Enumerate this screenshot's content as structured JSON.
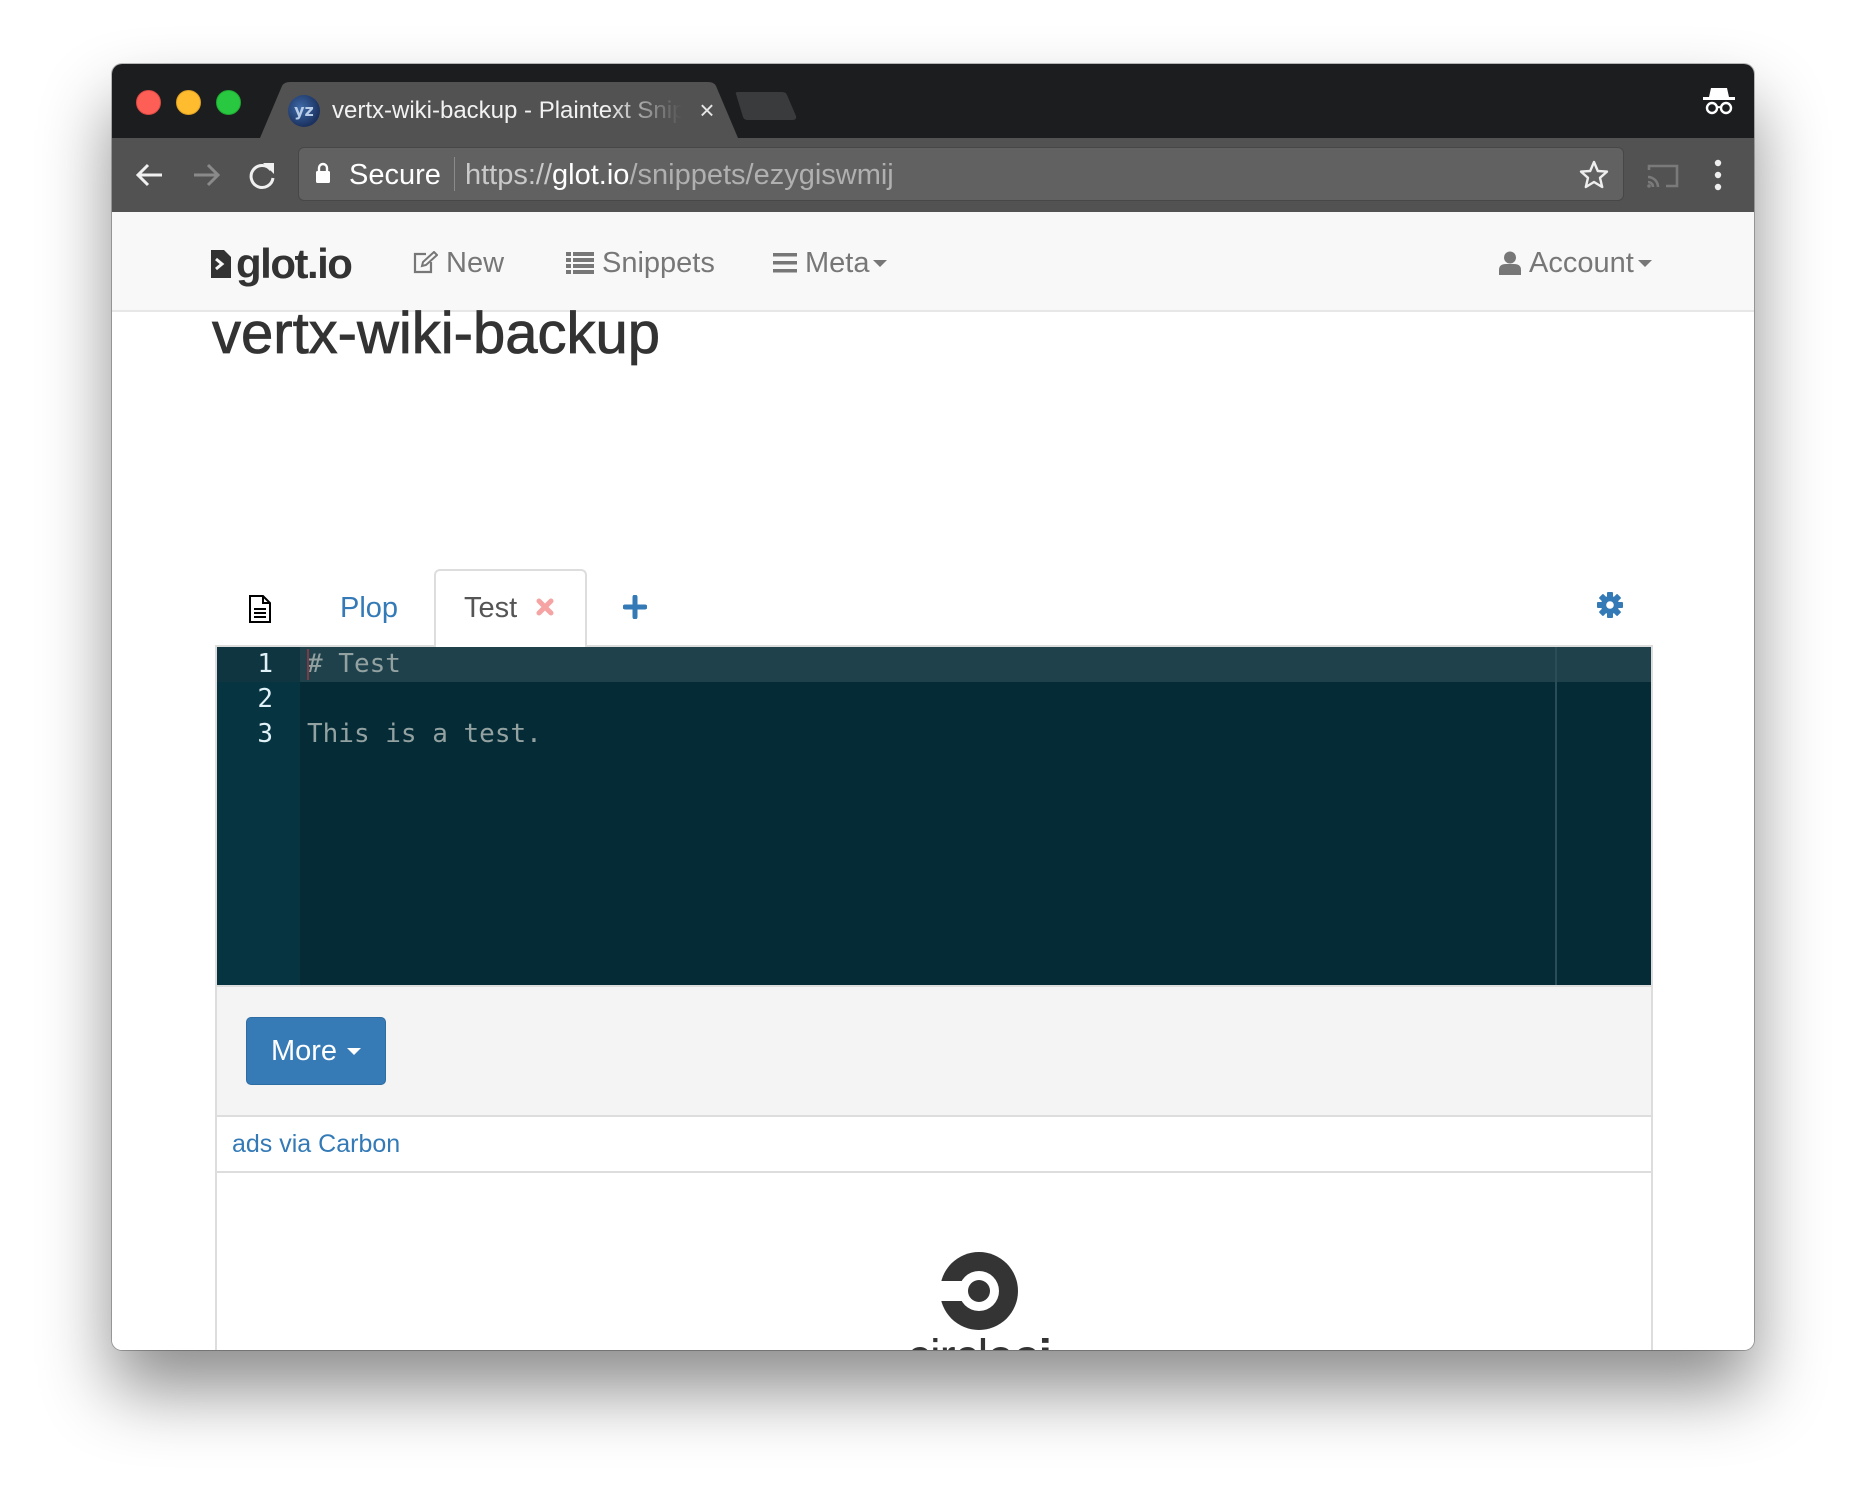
{
  "browser": {
    "tab": {
      "title": "vertx-wiki-backup - Plaintext Snippet",
      "favicon": "yz",
      "close_glyph": "×"
    },
    "toolbar": {
      "secure_label": "Secure",
      "url_scheme": "https://",
      "url_host": "glot.io",
      "url_path": "/snippets/ezygiswmij"
    },
    "icons": [
      "back-icon",
      "forward-icon",
      "reload-icon",
      "lock-icon",
      "star-icon",
      "cast-icon",
      "menu-dots-icon",
      "incognito-icon"
    ]
  },
  "navbar": {
    "brand": "glot.io",
    "items": [
      {
        "label": "New",
        "icon": "edit-icon"
      },
      {
        "label": "Snippets",
        "icon": "list-icon"
      },
      {
        "label": "Meta",
        "icon": "menu-icon",
        "dropdown": true
      },
      {
        "label": "Account",
        "icon": "user-icon",
        "dropdown": true
      }
    ]
  },
  "snippet": {
    "title": "vertx-wiki-backup",
    "tabs": [
      {
        "label": "Plop",
        "active": false
      },
      {
        "label": "Test",
        "active": true,
        "closable": true
      }
    ],
    "editor": {
      "lines": [
        {
          "number": "1",
          "text": "# Test"
        },
        {
          "number": "2",
          "text": ""
        },
        {
          "number": "3",
          "text": "This is a test."
        }
      ],
      "active_line": 1
    },
    "more_label": "More"
  },
  "ads": {
    "link_label": "ads via Carbon",
    "sponsor_regular": "circle",
    "sponsor_bold": "ci"
  },
  "colors": {
    "accent": "#337ab7",
    "close_tab": "#f5a3a3",
    "editor_bg": "#042b36",
    "editor_text": "#93a1a1"
  }
}
